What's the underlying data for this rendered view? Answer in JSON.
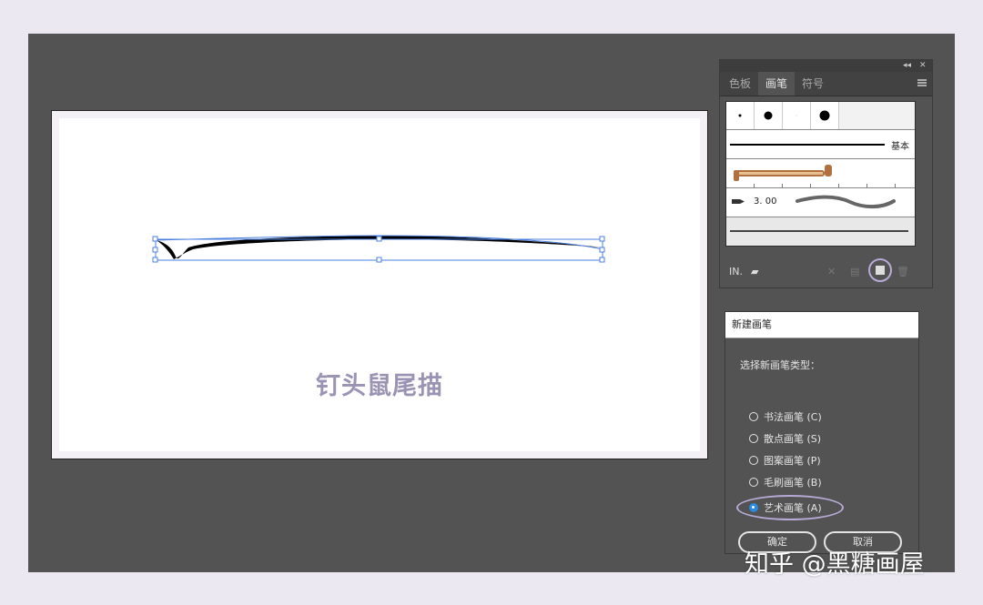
{
  "artboard": {
    "title": "钉头鼠尾描"
  },
  "brush_panel": {
    "tabs": [
      "色板",
      "画笔",
      "符号"
    ],
    "active_tab": "画笔",
    "basic_label": "基本",
    "pen_size": "3. 00",
    "library_icon": "IN.",
    "footer_icons": [
      "brush-library-icon",
      "brush-library-menu-icon",
      "remove-stroke-icon",
      "options-icon",
      "new-brush-icon",
      "delete-brush-icon"
    ]
  },
  "dialog": {
    "title": "新建画笔",
    "prompt": "选择新画笔类型：",
    "options": [
      {
        "label": "书法画笔 (C)",
        "checked": false
      },
      {
        "label": "散点画笔 (S)",
        "checked": false
      },
      {
        "label": "图案画笔 (P)",
        "checked": false
      },
      {
        "label": "毛刷画笔 (B)",
        "checked": false
      },
      {
        "label": "艺术画笔 (A)",
        "checked": true
      }
    ],
    "ok_label": "确定",
    "cancel_label": "取消"
  },
  "watermark": "知乎 @黑糖画屋",
  "colors": {
    "accent_highlight": "#b7aad6",
    "title_text": "#9b93b3",
    "radio_checked": "#2a8ae0"
  }
}
